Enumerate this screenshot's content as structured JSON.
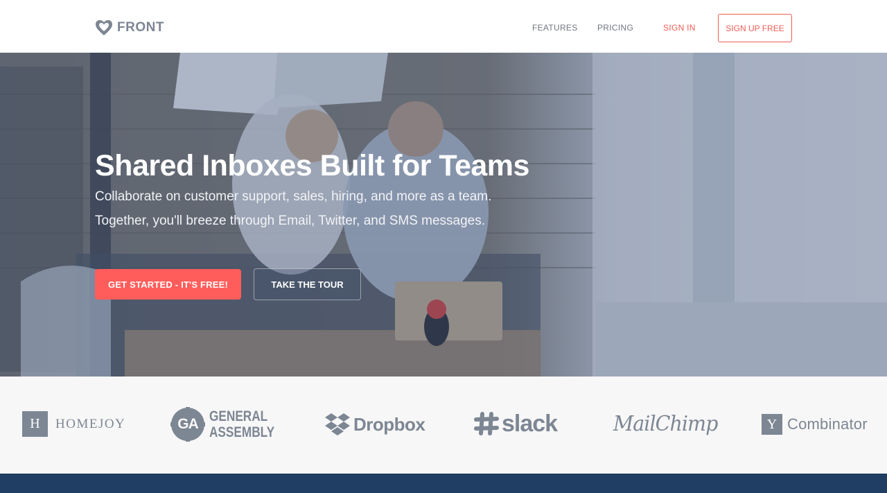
{
  "nav": {
    "brand": "FRONT",
    "links": {
      "features": "FEATURES",
      "pricing": "PRICING",
      "signin": "SIGN IN"
    },
    "signup_label": "SIGN UP FREE"
  },
  "hero": {
    "headline": "Shared Inboxes Built for Teams",
    "subtitle_line1": "Collaborate on customer support, sales, hiring, and more as a team.",
    "subtitle_line2": "Together, you'll breeze through Email, Twitter, and SMS messages.",
    "primary_cta": "GET STARTED - IT'S FREE!",
    "secondary_cta": "TAKE THE TOUR"
  },
  "customers": {
    "homejoy": {
      "mark": "H",
      "name": "HOMEJOY"
    },
    "general_assembly": {
      "mark": "GA",
      "line1": "GENERAL",
      "line2": "ASSEMBLY"
    },
    "dropbox": {
      "name": "Dropbox"
    },
    "slack": {
      "name": "slack"
    },
    "mailchimp": {
      "name": "MailChimp"
    },
    "ycombinator": {
      "mark": "Y",
      "name": "Combinator"
    }
  },
  "colors": {
    "accent": "#ff5d5b",
    "logo_gray": "#7d8693",
    "footer": "#203d63"
  }
}
